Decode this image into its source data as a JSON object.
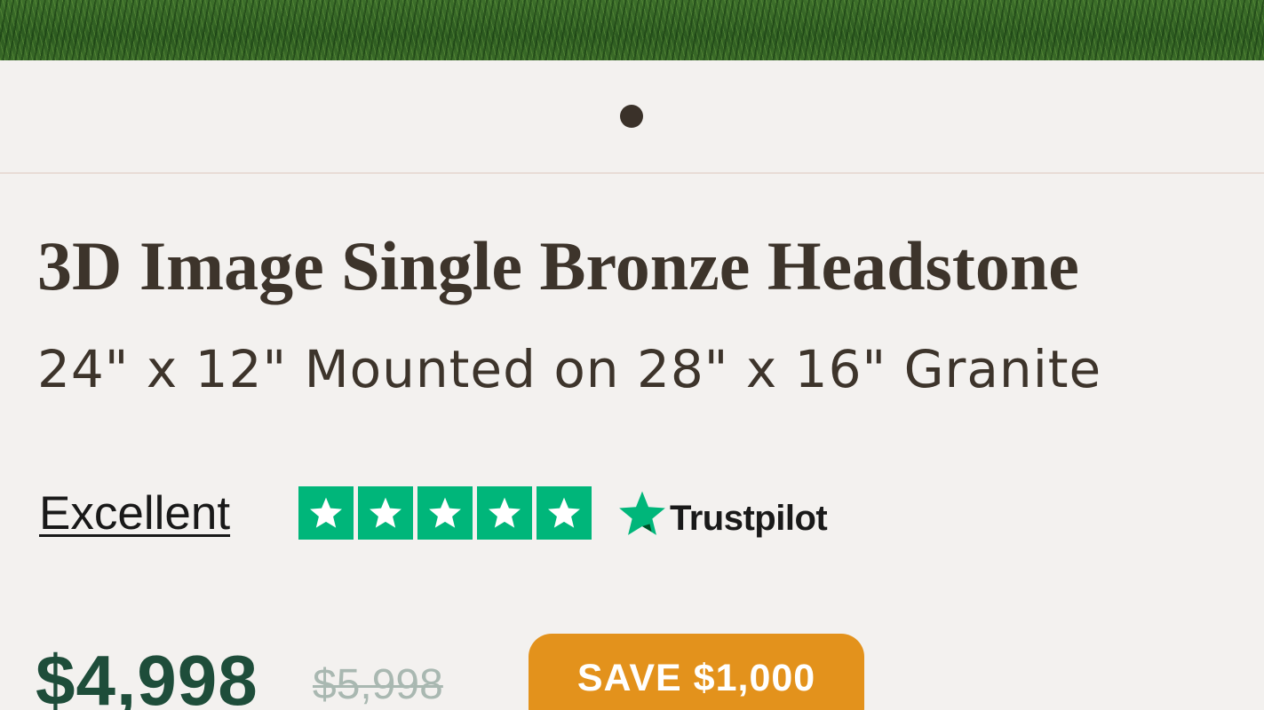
{
  "product": {
    "title": "3D Image Single Bronze Headstone",
    "subtitle": "24\" x 12\" Mounted on 28\" x 16\" Granite"
  },
  "carousel": {
    "dot_count": 1,
    "active_index": 0
  },
  "rating": {
    "label": "Excellent",
    "stars": 5,
    "max_stars": 5,
    "provider": "Trustpilot",
    "star_color": "#00b67a"
  },
  "pricing": {
    "current": "$4,998",
    "original": "$5,998",
    "savings_badge": "SAVE $1,000",
    "current_color": "#1e4d3a",
    "badge_color": "#e3921c"
  },
  "icons": {
    "star": "star-icon",
    "trustpilot": "trustpilot-star-icon"
  }
}
